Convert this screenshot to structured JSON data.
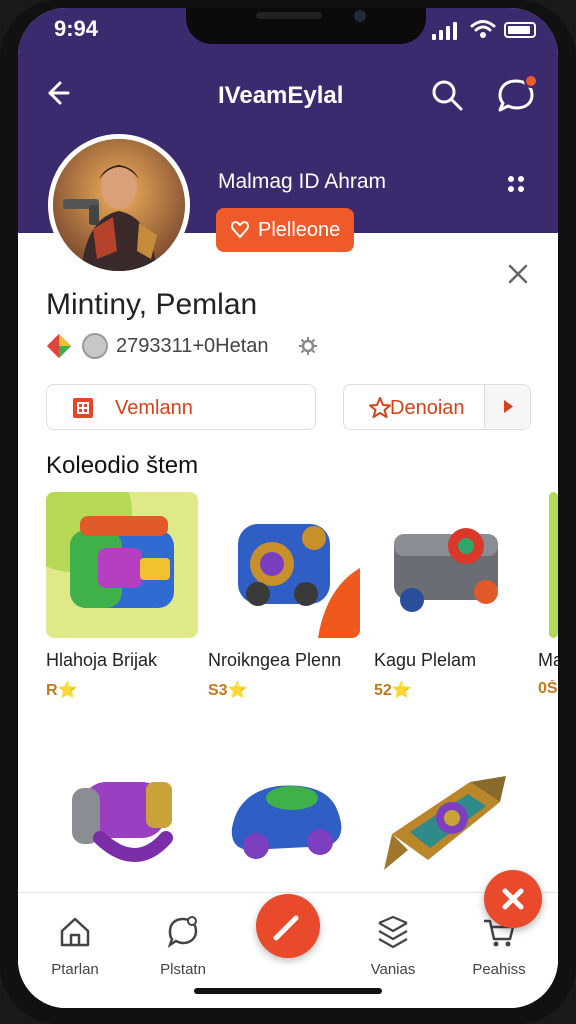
{
  "status": {
    "time": "9:94"
  },
  "header": {
    "title": "IVeamEylal",
    "back_icon": "back-arrow-icon",
    "search_icon": "search-icon",
    "chat_icon": "chat-icon"
  },
  "profile": {
    "handle": "Malmag ID Ahram",
    "follow_label": "Plelleone",
    "name": "Mintiny, Pemlan",
    "stats_text": "2793311+0Hetan"
  },
  "actions": {
    "left_label": "Vemlann",
    "right_label": "Denoian"
  },
  "collection": {
    "title": "Koleodio štem",
    "items": [
      {
        "name": "Hlahoja Brijak",
        "rating": "R⭐"
      },
      {
        "name": "Nroikngea Plenn",
        "rating": "S3⭐"
      },
      {
        "name": "Kagu Plelam",
        "rating": "52⭐"
      },
      {
        "name": "Ma",
        "rating": "0Š"
      }
    ]
  },
  "tabbar": {
    "tabs": [
      {
        "label": "Ptarlan",
        "icon": "home-icon"
      },
      {
        "label": "Plstatn",
        "icon": "chat-bubble-icon"
      },
      {
        "label": "Vanias",
        "icon": "layers-icon"
      },
      {
        "label": "Peahiss",
        "icon": "cart-icon"
      }
    ]
  },
  "colors": {
    "header_bg": "#3b2a6e",
    "accent": "#ef5a2b"
  }
}
